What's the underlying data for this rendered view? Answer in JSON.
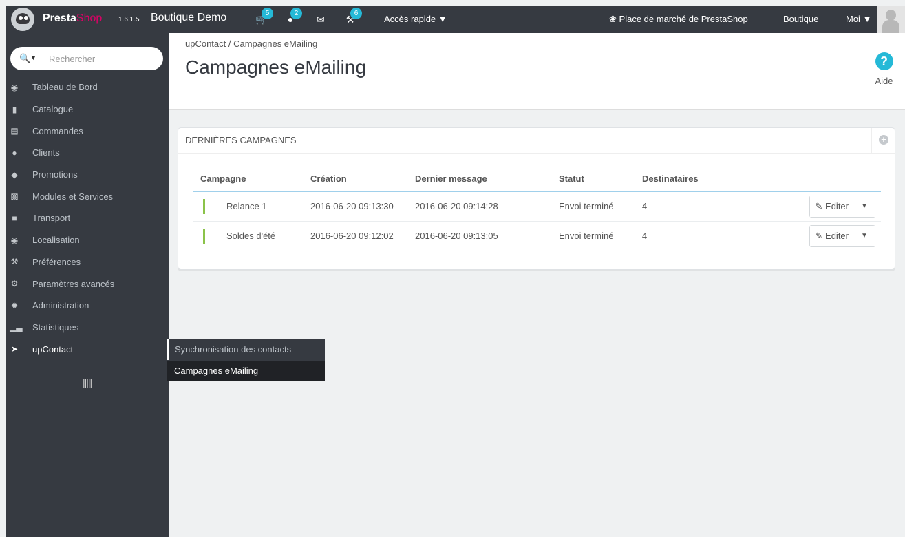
{
  "header": {
    "brand_presta": "Presta",
    "brand_shop": "Shop",
    "version": "1.6.1.5",
    "shop_name": "Boutique Demo",
    "orders_badge": "5",
    "customers_badge": "2",
    "trophy_badge": "6",
    "quick_access": "Accès rapide",
    "marketplace": "Place de marché de PrestaShop",
    "shop_link": "Boutique",
    "me": "Moi"
  },
  "sidebar": {
    "search_placeholder": "Rechercher",
    "items": [
      {
        "label": "Tableau de Bord",
        "icon": "dashboard-icon"
      },
      {
        "label": "Catalogue",
        "icon": "book-icon"
      },
      {
        "label": "Commandes",
        "icon": "credit-card-icon"
      },
      {
        "label": "Clients",
        "icon": "users-icon"
      },
      {
        "label": "Promotions",
        "icon": "tag-icon"
      },
      {
        "label": "Modules et Services",
        "icon": "puzzle-icon"
      },
      {
        "label": "Transport",
        "icon": "truck-icon"
      },
      {
        "label": "Localisation",
        "icon": "globe-icon"
      },
      {
        "label": "Préférences",
        "icon": "wrench-icon"
      },
      {
        "label": "Paramètres avancés",
        "icon": "cogs-icon"
      },
      {
        "label": "Administration",
        "icon": "cog-icon"
      },
      {
        "label": "Statistiques",
        "icon": "bar-chart-icon"
      },
      {
        "label": "upContact",
        "icon": "paper-plane-icon"
      }
    ],
    "submenu": [
      "Synchronisation des contacts",
      "Campagnes eMailing"
    ]
  },
  "page": {
    "breadcrumb": "upContact  /  Campagnes eMailing",
    "title": "Campagnes eMailing",
    "help": "Aide"
  },
  "panel": {
    "title": "DERNIÈRES CAMPAGNES",
    "columns": [
      "Campagne",
      "Création",
      "Dernier message",
      "Statut",
      "Destinataires"
    ],
    "rows": [
      {
        "campaign": "Relance 1",
        "created": "2016-06-20 09:13:30",
        "last": "2016-06-20 09:14:28",
        "status": "Envoi terminé",
        "recipients": "4"
      },
      {
        "campaign": "Soldes d'été",
        "created": "2016-06-20 09:12:02",
        "last": "2016-06-20 09:13:05",
        "status": "Envoi terminé",
        "recipients": "4"
      }
    ],
    "edit_label": "Editer"
  },
  "colors": {
    "header_bg": "#363a41",
    "accent": "#25b9d7",
    "brand_pink": "#df0067",
    "status_green": "#8bc34a"
  }
}
